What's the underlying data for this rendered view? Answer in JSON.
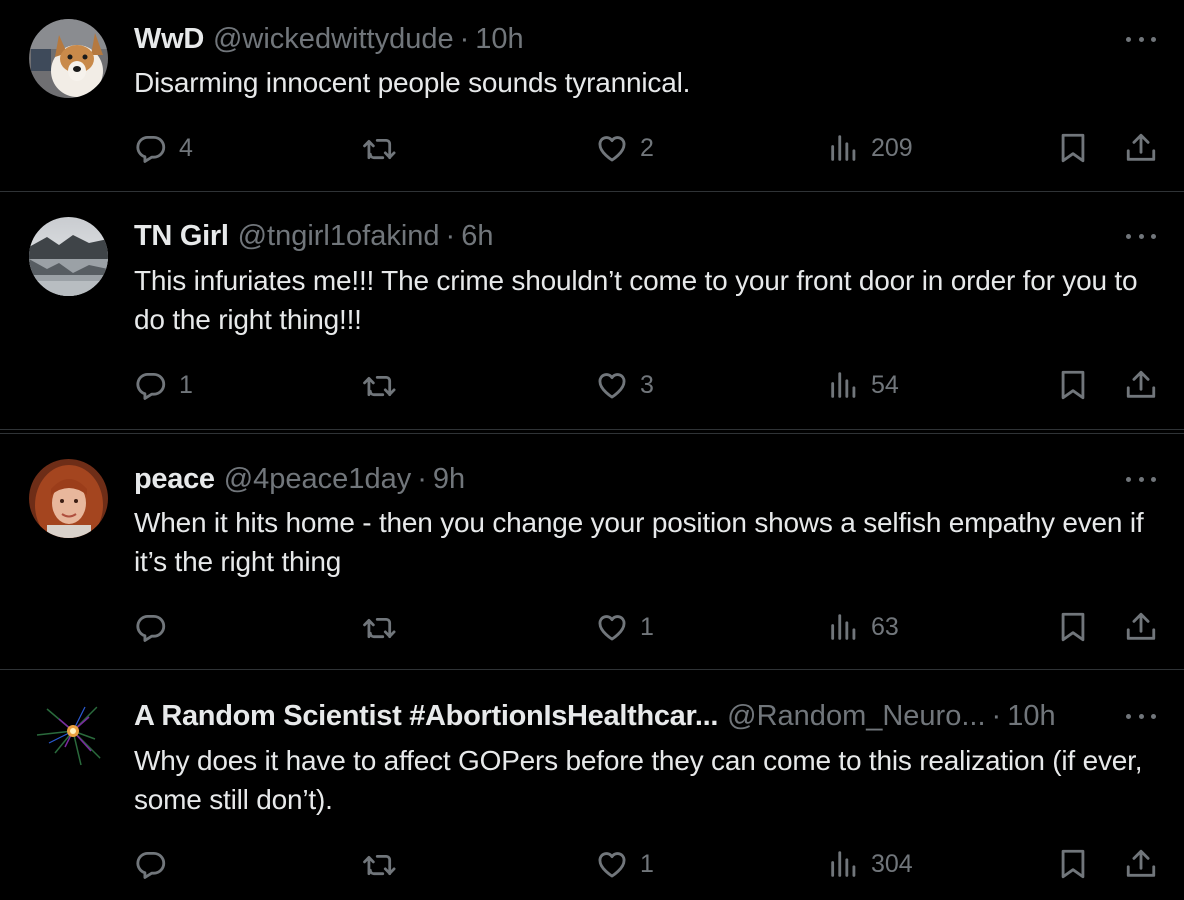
{
  "colors": {
    "background": "#000000",
    "text_primary": "#e7e9ea",
    "text_secondary": "#71767b",
    "divider": "#2f3336"
  },
  "icons": {
    "reply": "reply-icon",
    "retweet": "retweet-icon",
    "like": "like-icon",
    "views": "views-icon",
    "bookmark": "bookmark-icon",
    "share": "share-icon",
    "more": "more-icon"
  },
  "tweets": [
    {
      "name": "WwD",
      "handle": "@wickedwittydude",
      "separator": "·",
      "time": "10h",
      "text": "Disarming innocent people sounds tyrannical.",
      "replies": "4",
      "retweets": "",
      "likes": "2",
      "views": "209"
    },
    {
      "name": "TN Girl",
      "handle": "@tngirl1ofakind",
      "separator": "·",
      "time": "6h",
      "text": "This infuriates me!!! The crime shouldn’t come to your front door in order for you to do the right thing!!!",
      "replies": "1",
      "retweets": "",
      "likes": "3",
      "views": "54"
    },
    {
      "name": "peace",
      "handle": "@4peace1day",
      "separator": "·",
      "time": "9h",
      "text": "When it hits home - then you change your position shows a selfish empathy even if it’s the right thing",
      "replies": "",
      "retweets": "",
      "likes": "1",
      "views": "63"
    },
    {
      "name": "A Random Scientist #AbortionIsHealthcar...",
      "handle": "@Random_Neuro...",
      "separator": "·",
      "time": "10h",
      "text": "Why does it have to affect GOPers before they can come to this realization (if ever, some still don’t).",
      "replies": "",
      "retweets": "",
      "likes": "1",
      "views": "304"
    }
  ]
}
